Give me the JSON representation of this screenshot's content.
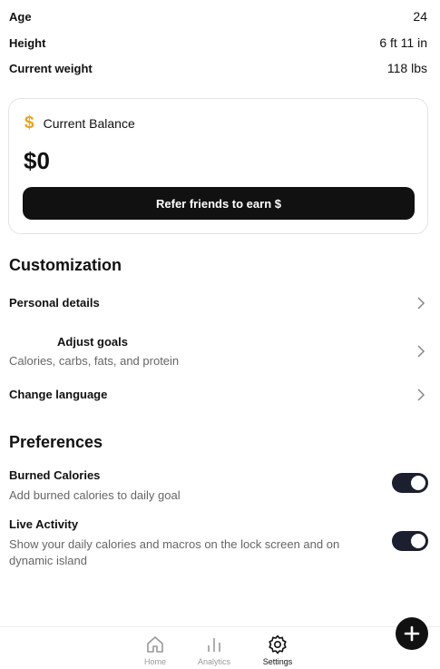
{
  "profile": {
    "age": {
      "label": "Age",
      "value": "24"
    },
    "height": {
      "label": "Height",
      "value": "6 ft 11 in"
    },
    "weight": {
      "label": "Current weight",
      "value": "118 lbs"
    }
  },
  "balance": {
    "title": "Current Balance",
    "amount": "$0",
    "icon": "dollar-icon",
    "icon_color": "#f0a11c",
    "button_label": "Refer friends to earn $"
  },
  "customization": {
    "title": "Customization",
    "items": [
      {
        "label": "Personal details"
      },
      {
        "label": "Adjust goals",
        "sub": "Calories, carbs, fats, and protein"
      },
      {
        "label": "Change language"
      }
    ]
  },
  "preferences": {
    "title": "Preferences",
    "items": [
      {
        "label": "Burned Calories",
        "sub": "Add burned calories to daily goal",
        "enabled": true
      },
      {
        "label": "Live Activity",
        "sub": "Show your daily calories and macros on the lock screen and on dynamic island",
        "enabled": true
      }
    ]
  },
  "nav": {
    "items": [
      {
        "label": "Home",
        "icon": "home-icon"
      },
      {
        "label": "Analytics",
        "icon": "analytics-icon"
      },
      {
        "label": "Settings",
        "icon": "gear-icon",
        "active": true
      }
    ],
    "fab_icon": "plus-icon"
  }
}
